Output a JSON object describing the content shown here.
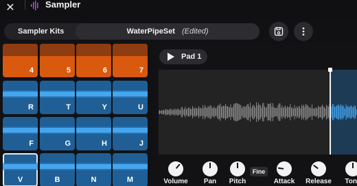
{
  "app": {
    "title": "Sampler"
  },
  "toolbar": {
    "kits_label": "Sampler Kits",
    "kit_name": "WaterPipeSet",
    "kit_status": "(Edited)"
  },
  "pads": [
    {
      "label": "4",
      "color": "orange"
    },
    {
      "label": "5",
      "color": "orange"
    },
    {
      "label": "6",
      "color": "orange"
    },
    {
      "label": "7",
      "color": "orange"
    },
    {
      "label": "R",
      "color": "blue"
    },
    {
      "label": "T",
      "color": "blue"
    },
    {
      "label": "Y",
      "color": "blue"
    },
    {
      "label": "U",
      "color": "blue"
    },
    {
      "label": "F",
      "color": "blue"
    },
    {
      "label": "G",
      "color": "blue"
    },
    {
      "label": "H",
      "color": "blue"
    },
    {
      "label": "J",
      "color": "blue"
    },
    {
      "label": "V",
      "color": "blue",
      "selected": true
    },
    {
      "label": "B",
      "color": "blue"
    },
    {
      "label": "N",
      "color": "blue"
    },
    {
      "label": "M",
      "color": "blue"
    }
  ],
  "editor": {
    "pad_name": "Pad 1",
    "fine_label": "Fine"
  },
  "knobs": [
    {
      "label": "Volume",
      "value": 0.65
    },
    {
      "label": "Pan",
      "value": 0.5
    },
    {
      "label": "Pitch",
      "value": 0.5
    },
    {
      "label": "Attack",
      "value": 0.2
    },
    {
      "label": "Release",
      "value": 0.3
    },
    {
      "label": "Tone",
      "value": 0.5
    }
  ],
  "colors": {
    "orange_pad": "#d9590e",
    "blue_pad": "#1f5f96",
    "waveform": "#8a8a8a",
    "waveform_selected": "#44a6ef"
  }
}
